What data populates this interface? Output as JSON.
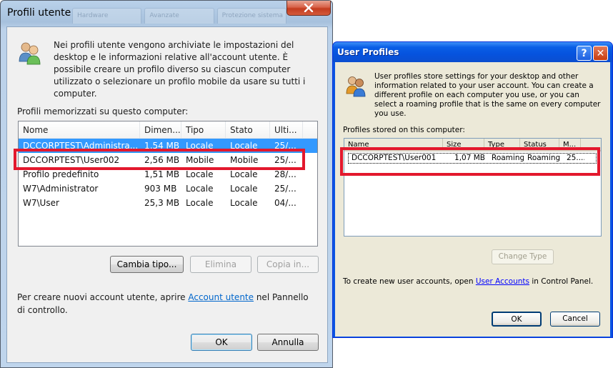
{
  "italian_dialog": {
    "title": "Profili utente",
    "bg_tabs": [
      "Hardware",
      "Avanzate",
      "Protezione sistema"
    ],
    "description": "Nei profili utente vengono archiviate le impostazioni del desktop e le informazioni relative all'account utente. È possibile creare un profilo diverso su ciascun computer utilizzato o selezionare un profilo mobile da usare su tutti i computer.",
    "list_label": "Profili memorizzati su questo computer:",
    "columns": [
      "Nome",
      "Dimen...",
      "Tipo",
      "Stato",
      "Ulti..."
    ],
    "rows": [
      {
        "name": "DCCORPTEST\\Administra...",
        "size": "1,54 MB",
        "type": "Locale",
        "status": "Locale",
        "last": "25/..."
      },
      {
        "name": "DCCORPTEST\\User002",
        "size": "2,56 MB",
        "type": "Mobile",
        "status": "Mobile",
        "last": "25/..."
      },
      {
        "name": "Profilo predefinito",
        "size": "1,51 MB",
        "type": "Locale",
        "status": "Locale",
        "last": "28/..."
      },
      {
        "name": "W7\\Administrator",
        "size": "903 MB",
        "type": "Locale",
        "status": "Locale",
        "last": "25/..."
      },
      {
        "name": "W7\\User",
        "size": "25,3 MB",
        "type": "Locale",
        "status": "Locale",
        "last": "04/..."
      }
    ],
    "buttons": {
      "change_type": "Cambia tipo...",
      "delete": "Elimina",
      "copy": "Copia in...",
      "ok": "OK",
      "cancel": "Annulla"
    },
    "footer_prefix": "Per creare nuovi account utente, aprire ",
    "footer_link": "Account utente",
    "footer_suffix": " nel Pannello di controllo."
  },
  "english_dialog": {
    "title": "User Profiles",
    "description": "User profiles store settings for your desktop and other information related to your user account. You can create a different profile on each computer you use, or you can select a roaming profile that is the same on every computer you use.",
    "list_label": "Profiles stored on this computer:",
    "columns": [
      "Name",
      "Size",
      "Type",
      "Status",
      "M..."
    ],
    "rows": [
      {
        "name": "DCCORPTEST\\User001",
        "size": "1,07 MB",
        "type": "Roaming",
        "status": "Roaming",
        "last": "25...."
      }
    ],
    "buttons": {
      "change_type": "Change Type",
      "ok": "OK",
      "cancel": "Cancel"
    },
    "footer_prefix": "To create new user accounts, open ",
    "footer_link": "User Accounts",
    "footer_suffix": " in Control Panel."
  },
  "colors": {
    "selection": "#3399ff",
    "highlight": "#e3182d",
    "xp_titlebar": "#0a54e3"
  }
}
